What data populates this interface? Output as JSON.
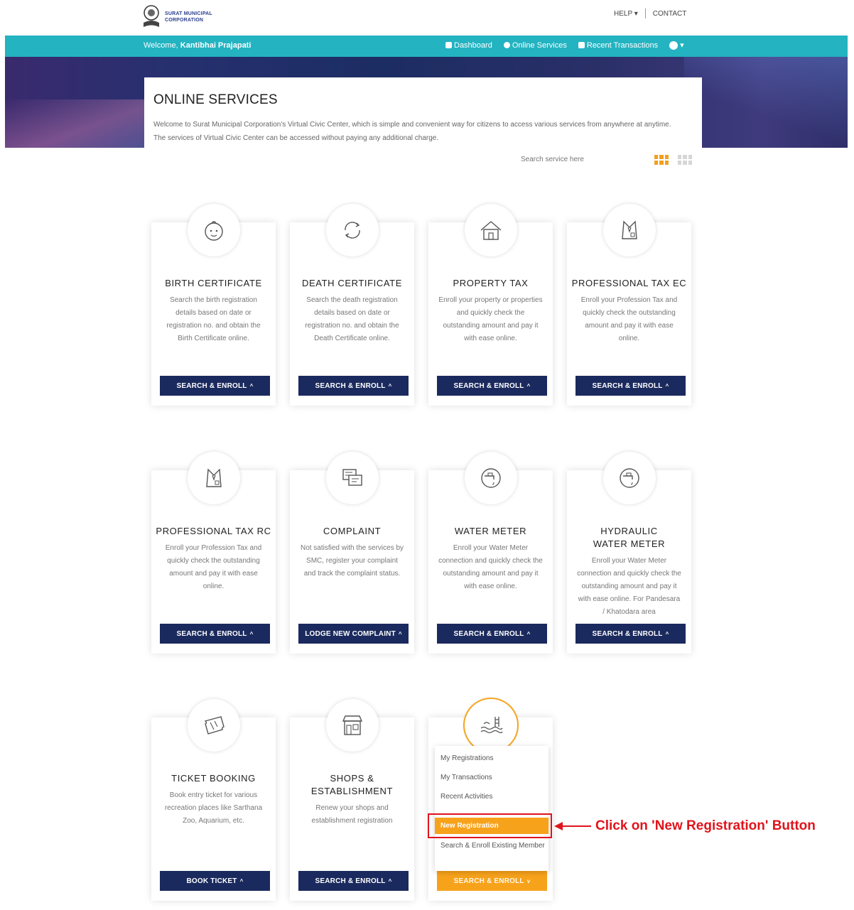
{
  "header": {
    "logo_text": "SURAT MUNICIPAL CORPORATION",
    "help": "HELP",
    "contact": "CONTACT"
  },
  "navbar": {
    "welcome_prefix": "Welcome,",
    "user_name": "Kantibhai Prajapati",
    "dashboard": "Dashboard",
    "online_services": "Online Services",
    "recent_transactions": "Recent Transactions"
  },
  "panel": {
    "title": "ONLINE SERVICES",
    "description": "Welcome to Surat Municipal Corporation's Virtual Civic Center, which is simple and convenient way for citizens to access various services from anywhere at anytime. The services of Virtual Civic Center can be accessed without paying any additional charge.",
    "search_placeholder": "Search service here"
  },
  "cards": [
    {
      "title": "BIRTH CERTIFICATE",
      "desc": "Search the birth registration details based on date or registration no. and obtain the Birth Certificate online.",
      "button": "SEARCH & ENROLL",
      "icon": "baby-icon"
    },
    {
      "title": "DEATH CERTIFICATE",
      "desc": "Search the death registration details based on date or registration no. and obtain the Death Certificate online.",
      "button": "SEARCH & ENROLL",
      "icon": "cycle-icon"
    },
    {
      "title": "PROPERTY TAX",
      "desc": "Enroll your property or properties and quickly check the outstanding amount and pay it with ease online.",
      "button": "SEARCH & ENROLL",
      "icon": "house-icon"
    },
    {
      "title": "PROFESSIONAL TAX EC",
      "desc": "Enroll your Profession Tax and quickly check the outstanding amount and pay it with ease online.",
      "button": "SEARCH & ENROLL",
      "icon": "suit-icon"
    },
    {
      "title": "PROFESSIONAL TAX RC",
      "desc": "Enroll your Profession Tax and quickly check the outstanding amount and pay it with ease online.",
      "button": "SEARCH & ENROLL",
      "icon": "suit-icon"
    },
    {
      "title": "COMPLAINT",
      "desc": "Not satisfied with the services by SMC, register your complaint and track the complaint status.",
      "button": "LODGE NEW COMPLAINT",
      "icon": "chat-icon"
    },
    {
      "title": "WATER METER",
      "desc": "Enroll your Water Meter connection and quickly check the outstanding amount and pay it with ease online.",
      "button": "SEARCH & ENROLL",
      "icon": "tap-icon"
    },
    {
      "title": "HYDRAULIC WATER METER",
      "desc": "Enroll your Water Meter connection and quickly check the outstanding amount and pay it with ease online. For Pandesara / Khatodara area",
      "button": "SEARCH & ENROLL",
      "icon": "tap-icon"
    },
    {
      "title": "TICKET BOOKING",
      "desc": "Book entry ticket for various recreation places like Sarthana Zoo, Aquarium, etc.",
      "button": "BOOK TICKET",
      "icon": "ticket-icon"
    },
    {
      "title": "SHOPS & ESTABLISHMENT",
      "desc": "Renew your shops and establishment registration",
      "button": "SEARCH & ENROLL",
      "icon": "shop-icon"
    },
    {
      "title": "",
      "desc": "",
      "button": "SEARCH & ENROLL",
      "icon": "pool-icon"
    }
  ],
  "dropdown": {
    "items": [
      "My Registrations",
      "My Transactions",
      "Recent Activities",
      "New Registration",
      "Search & Enroll Existing Member"
    ]
  },
  "annotation": "Click on 'New Registration' Button",
  "colors": {
    "navbar": "#23b3c1",
    "button_dark": "#1b2a5e",
    "button_active": "#f7a21b",
    "annotation": "#e0141c"
  }
}
